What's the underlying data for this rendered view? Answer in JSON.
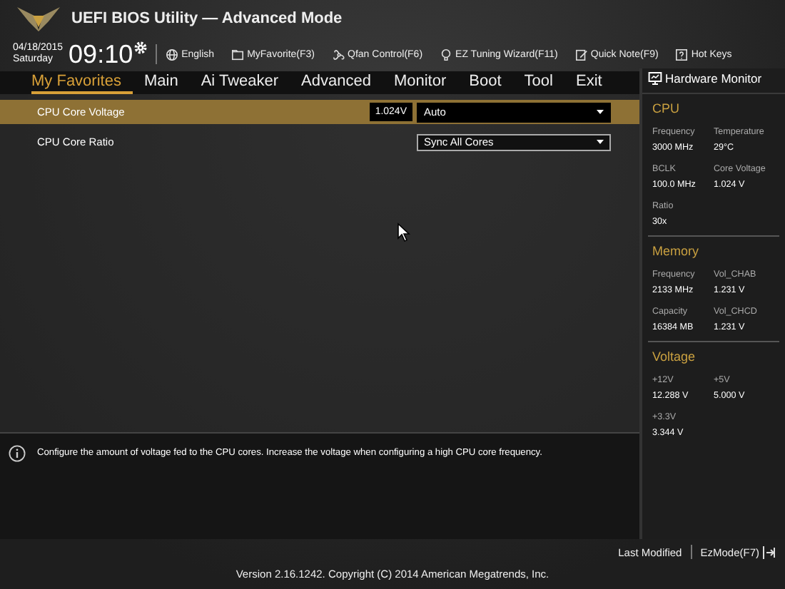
{
  "header": {
    "title": "UEFI BIOS Utility — Advanced Mode",
    "date": "04/18/2015",
    "day": "Saturday",
    "time": "09:10",
    "toolbar": [
      {
        "label": "English"
      },
      {
        "label": "MyFavorite(F3)"
      },
      {
        "label": "Qfan Control(F6)"
      },
      {
        "label": "EZ Tuning Wizard(F11)"
      },
      {
        "label": "Quick Note(F9)"
      },
      {
        "label": "Hot Keys"
      }
    ]
  },
  "tabs": [
    {
      "label": "My Favorites",
      "selected": true
    },
    {
      "label": "Main",
      "selected": false
    },
    {
      "label": "Ai Tweaker",
      "selected": false
    },
    {
      "label": "Advanced",
      "selected": false
    },
    {
      "label": "Monitor",
      "selected": false
    },
    {
      "label": "Boot",
      "selected": false
    },
    {
      "label": "Tool",
      "selected": false
    },
    {
      "label": "Exit",
      "selected": false
    }
  ],
  "settings": [
    {
      "label": "CPU Core Voltage",
      "reading": "1.024V",
      "value": "Auto",
      "selected": true
    },
    {
      "label": "CPU Core Ratio",
      "value": "Sync All Cores",
      "selected": false
    }
  ],
  "hardware_monitor": {
    "title": "Hardware Monitor",
    "sections": [
      {
        "title": "CPU",
        "items": [
          {
            "label": "Frequency",
            "value": "3000 MHz"
          },
          {
            "label": "Temperature",
            "value": "29°C"
          },
          {
            "label": "BCLK",
            "value": "100.0 MHz"
          },
          {
            "label": "Core Voltage",
            "value": "1.024 V"
          },
          {
            "label": "Ratio",
            "value": "30x"
          }
        ]
      },
      {
        "title": "Memory",
        "items": [
          {
            "label": "Frequency",
            "value": "2133 MHz"
          },
          {
            "label": "Vol_CHAB",
            "value": "1.231 V"
          },
          {
            "label": "Capacity",
            "value": "16384 MB"
          },
          {
            "label": "Vol_CHCD",
            "value": "1.231 V"
          }
        ]
      },
      {
        "title": "Voltage",
        "items": [
          {
            "label": "+12V",
            "value": "12.288 V"
          },
          {
            "label": "+5V",
            "value": "5.000 V"
          },
          {
            "label": "+3.3V",
            "value": "3.344 V"
          }
        ]
      }
    ]
  },
  "help": {
    "text": "Configure the amount of voltage fed to the CPU cores. Increase the voltage when configuring a high CPU core frequency."
  },
  "footer": {
    "last_modified": "Last Modified",
    "ezmode": "EzMode(F7)",
    "version": "Version 2.16.1242. Copyright (C) 2014 American Megatrends, Inc."
  }
}
